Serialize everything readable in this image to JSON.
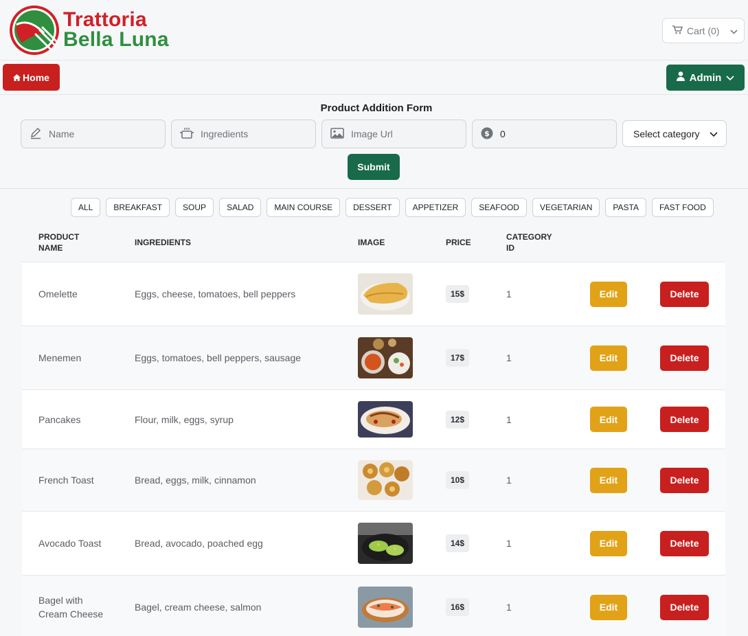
{
  "header": {
    "brand_line1": "Trattoria",
    "brand_line2": "Bella Luna",
    "cart_label": "Cart (0)"
  },
  "nav": {
    "home_label": "Home",
    "admin_label": "Admin"
  },
  "form": {
    "title": "Product Addition Form",
    "name_placeholder": "Name",
    "ingredients_placeholder": "Ingredients",
    "image_url_placeholder": "Image Url",
    "price_value": "0",
    "category_placeholder": "Select category",
    "submit_label": "Submit"
  },
  "categories": [
    "ALL",
    "BREAKFAST",
    "SOUP",
    "SALAD",
    "MAIN COURSE",
    "DESSERT",
    "APPETIZER",
    "SEAFOOD",
    "VEGETARIAN",
    "PASTA",
    "FAST FOOD"
  ],
  "table": {
    "headers": {
      "name": "PRODUCT NAME",
      "ingredients": "INGREDIENTS",
      "image": "IMAGE",
      "price": "PRICE",
      "category": "CATEGORY ID"
    },
    "edit_label": "Edit",
    "delete_label": "Delete",
    "rows": [
      {
        "name": "Omelette",
        "ingredients": "Eggs, cheese, tomatoes, bell peppers",
        "price": "15$",
        "category_id": "1"
      },
      {
        "name": "Menemen",
        "ingredients": "Eggs, tomatoes, bell peppers, sausage",
        "price": "17$",
        "category_id": "1"
      },
      {
        "name": "Pancakes",
        "ingredients": "Flour, milk, eggs, syrup",
        "price": "12$",
        "category_id": "1"
      },
      {
        "name": "French Toast",
        "ingredients": "Bread, eggs, milk, cinnamon",
        "price": "10$",
        "category_id": "1"
      },
      {
        "name": "Avocado Toast",
        "ingredients": "Bread, avocado, poached egg",
        "price": "14$",
        "category_id": "1"
      },
      {
        "name": "Bagel with Cream Cheese",
        "ingredients": "Bagel, cream cheese, salmon",
        "price": "16$",
        "category_id": "1"
      }
    ]
  },
  "colors": {
    "brand_red": "#c8201f",
    "brand_green": "#186a4a",
    "edit_yellow": "#e2a217"
  }
}
